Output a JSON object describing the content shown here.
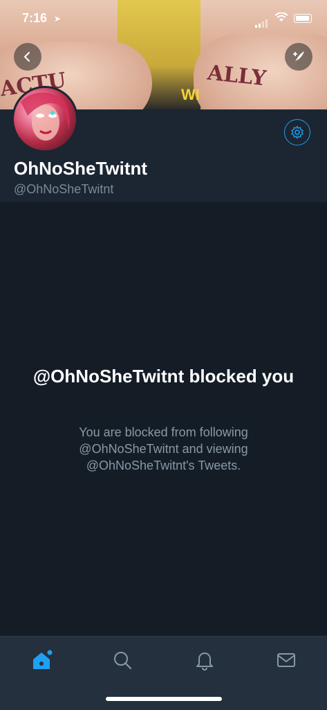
{
  "status_bar": {
    "time": "7:16"
  },
  "banner": {
    "tattoo_left": "ACTU",
    "tattoo_right": "ALLY",
    "art_text": "WI"
  },
  "profile": {
    "display_name": "OhNoSheTwitnt",
    "handle": "@OhNoSheTwitnt"
  },
  "blocked": {
    "title": "@OhNoSheTwitnt blocked you",
    "message": "You are blocked from following @OhNoSheTwitnt and viewing @OhNoSheTwitnt's Tweets."
  },
  "colors": {
    "accent": "#1da1f2",
    "background": "#141d26",
    "header": "#1c2632",
    "tabbar": "#24303d"
  },
  "tabs": [
    {
      "icon": "home-icon",
      "active": true
    },
    {
      "icon": "search-icon",
      "active": false
    },
    {
      "icon": "bell-icon",
      "active": false
    },
    {
      "icon": "mail-icon",
      "active": false
    }
  ]
}
